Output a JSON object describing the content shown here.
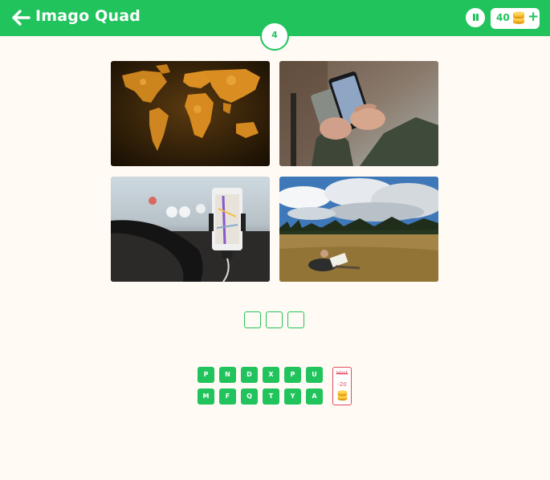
{
  "header": {
    "title": "Imago Quad",
    "coins": "40",
    "plus": "+",
    "level": "4",
    "colors": {
      "accent": "#21c35c",
      "background": "#fffaf4",
      "hint": "#e64a5c",
      "coin": "#f5b623"
    }
  },
  "puzzle": {
    "images": [
      {
        "icon": "world-map-photo"
      },
      {
        "icon": "smartphone-in-hands-photo"
      },
      {
        "icon": "car-phone-navigation-photo"
      },
      {
        "icon": "hiker-reading-map-photo"
      }
    ],
    "answer_slots": [
      "",
      "",
      ""
    ]
  },
  "keyboard": {
    "row1": [
      "P",
      "N",
      "D",
      "X",
      "P",
      "U"
    ],
    "row2": [
      "M",
      "F",
      "Q",
      "T",
      "Y",
      "A"
    ]
  },
  "hint": {
    "label": "Hint",
    "cost": "-20"
  }
}
